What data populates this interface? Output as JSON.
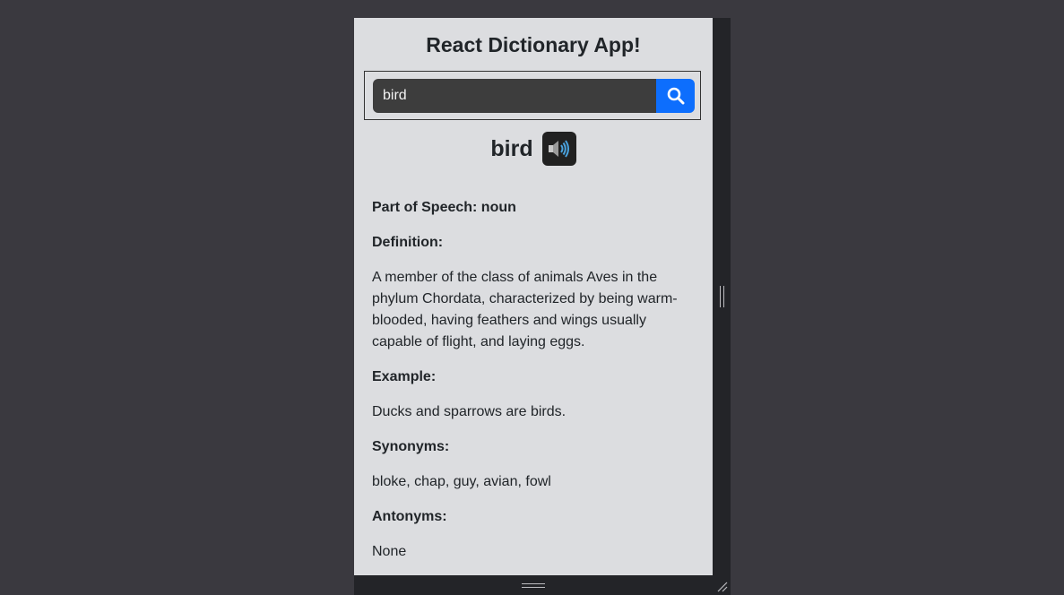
{
  "app": {
    "title": "React Dictionary App!"
  },
  "search": {
    "value": "bird",
    "button_icon": "search-icon"
  },
  "entry": {
    "word": "bird",
    "audio_icon": "speaker-icon",
    "part_of_speech_label": "Part of Speech: noun",
    "definition_label": "Definition:",
    "definition": "A member of the class of animals Aves in the phylum Chordata, characterized by being warm-blooded, having feathers and wings usually capable of flight, and laying eggs.",
    "example_label": "Example:",
    "example": "Ducks and sparrows are birds.",
    "synonyms_label": "Synonyms:",
    "synonyms": "bloke, chap, guy, avian, fowl",
    "antonyms_label": "Antonyms:",
    "antonyms": "None"
  },
  "colors": {
    "page_background": "#3a393f",
    "app_background": "#dcdde0",
    "accent": "#0d6efd",
    "input_background": "#3d3d3d"
  }
}
